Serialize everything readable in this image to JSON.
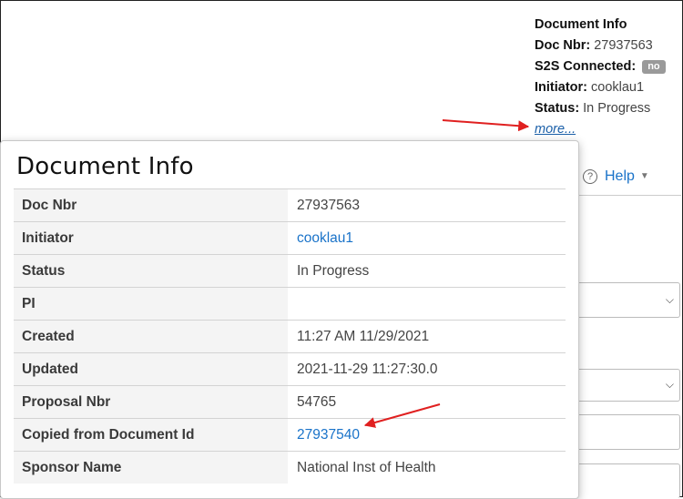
{
  "header": {
    "title": "Document Info",
    "rows": [
      {
        "key": "Doc Nbr:",
        "value": "27937563"
      },
      {
        "key": "S2S Connected:",
        "badge": "no"
      },
      {
        "key": "Initiator:",
        "value": "cooklau1"
      },
      {
        "key": "Status:",
        "value": "In Progress"
      }
    ],
    "more_link": "more..."
  },
  "help": {
    "label": "Help",
    "icon": "question-circle-icon"
  },
  "popup": {
    "title": "Document Info",
    "rows": [
      {
        "label": "Doc Nbr",
        "value": "27937563"
      },
      {
        "label": "Initiator",
        "value": "cooklau1"
      },
      {
        "label": "Status",
        "value": "In Progress"
      },
      {
        "label": "PI",
        "value": ""
      },
      {
        "label": "Created",
        "value": "11:27 AM 11/29/2021"
      },
      {
        "label": "Updated",
        "value": "2021-11-29 11:27:30.0"
      },
      {
        "label": "Proposal Nbr",
        "value": "54765"
      },
      {
        "label": "Copied from Document Id",
        "value": "27937540"
      },
      {
        "label": "Sponsor Name",
        "value": "National Inst of Health"
      }
    ]
  },
  "colors": {
    "link": "#1a73c9",
    "annotation_arrow": "#e02020",
    "badge": "#9a9a9a"
  }
}
